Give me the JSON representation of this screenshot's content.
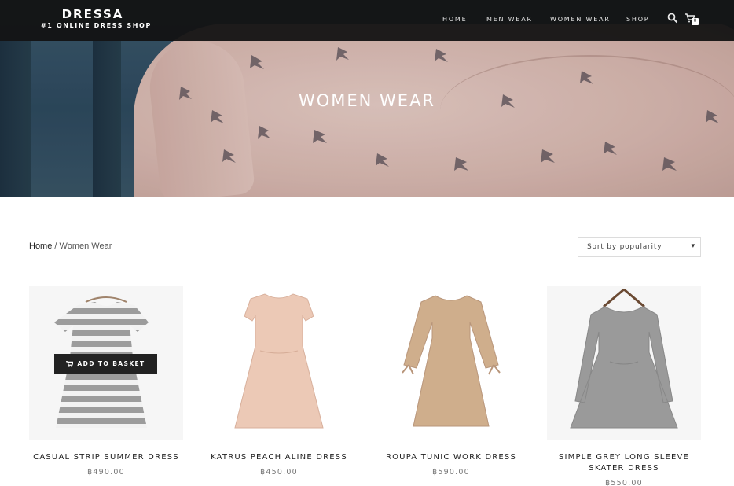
{
  "brand": {
    "name": "DRESSA",
    "tagline": "#1 ONLINE DRESS SHOP"
  },
  "nav": {
    "items": [
      {
        "label": "HOME"
      },
      {
        "label": "MEN WEAR"
      },
      {
        "label": "WOMEN WEAR"
      },
      {
        "label": "SHOP"
      }
    ],
    "search_icon": "search-icon",
    "cart_icon": "basket-icon",
    "cart_count": "0"
  },
  "hero": {
    "title": "WOMEN WEAR"
  },
  "breadcrumb": {
    "home": "Home",
    "separator": " / ",
    "current": "Women Wear"
  },
  "sort": {
    "selected": "Sort by popularity",
    "caret": "▾"
  },
  "products": [
    {
      "name": "CASUAL STRIP SUMMER DRESS",
      "price": "฿490.00",
      "hover_button": "ADD TO BASKET"
    },
    {
      "name": "KATRUS PEACH ALINE DRESS",
      "price": "฿450.00"
    },
    {
      "name": "ROUPA TUNIC WORK DRESS",
      "price": "฿590.00"
    },
    {
      "name": "SIMPLE GREY LONG SLEEVE SKATER DRESS",
      "price": "฿550.00"
    }
  ],
  "colors": {
    "nav_bar": "#121212",
    "button": "#222222",
    "price_text": "#777777"
  }
}
